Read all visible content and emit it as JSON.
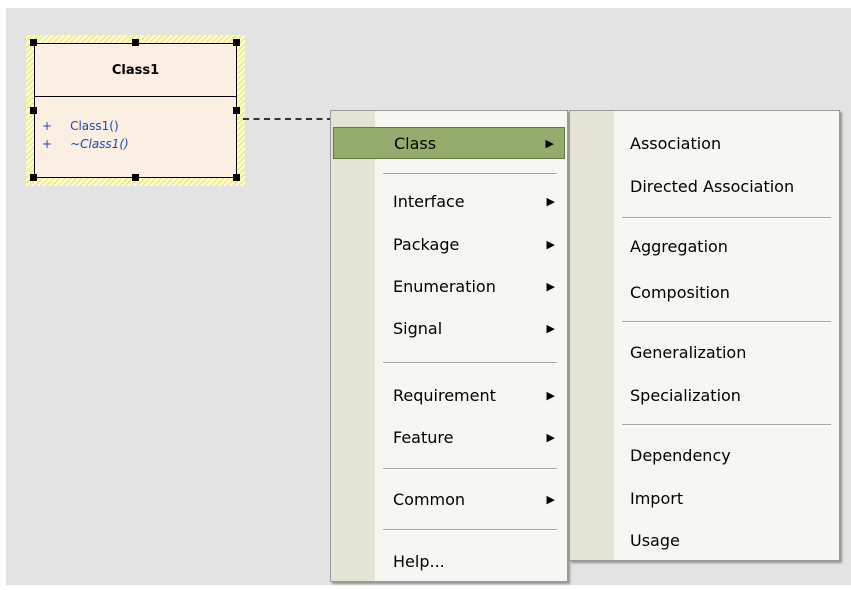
{
  "class_element": {
    "name": "Class1",
    "operations": [
      {
        "visibility": "+",
        "signature": "Class1()",
        "italic": false
      },
      {
        "visibility": "+",
        "signature": "~Class1()",
        "italic": true
      }
    ]
  },
  "context_menu": {
    "items": [
      {
        "label": "Class",
        "has_submenu": true,
        "active": true
      },
      {
        "label": "Interface",
        "has_submenu": true
      },
      {
        "label": "Package",
        "has_submenu": true
      },
      {
        "label": "Enumeration",
        "has_submenu": true
      },
      {
        "label": "Signal",
        "has_submenu": true
      },
      {
        "label": "Requirement",
        "has_submenu": true
      },
      {
        "label": "Feature",
        "has_submenu": true
      },
      {
        "label": "Common",
        "has_submenu": true
      },
      {
        "label": "Help...",
        "has_submenu": false
      }
    ]
  },
  "class_submenu": {
    "items": [
      {
        "label": "Association"
      },
      {
        "label": "Directed Association"
      },
      {
        "label": "Aggregation"
      },
      {
        "label": "Composition"
      },
      {
        "label": "Generalization"
      },
      {
        "label": "Specialization"
      },
      {
        "label": "Dependency"
      },
      {
        "label": "Import"
      },
      {
        "label": "Usage"
      }
    ]
  },
  "colors": {
    "highlight": "#95ad6c",
    "class_fill": "#fbeee2",
    "canvas": "#e3e3e3",
    "operation_text": "#1f4aa8"
  }
}
